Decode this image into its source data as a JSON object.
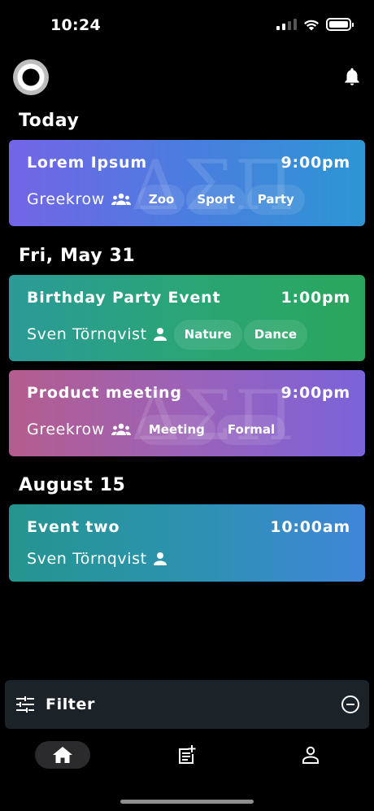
{
  "status_bar": {
    "time": "10:24"
  },
  "sections": [
    {
      "title": "Today"
    },
    {
      "title": "Fri, May 31"
    },
    {
      "title": "August 15"
    }
  ],
  "events": [
    {
      "title": "Lorem Ipsum",
      "time": "9:00pm",
      "owner": "Greekrow",
      "owner_icon": "group-icon",
      "watermark": "ΔΣΠ",
      "tags": [
        "Zoo",
        "Sport",
        "Party"
      ],
      "colors": [
        "#7465e6",
        "#2d96d4"
      ]
    },
    {
      "title": "Birthday Party Event",
      "time": "1:00pm",
      "owner": "Sven Törnqvist",
      "owner_icon": "person-icon",
      "tags": [
        "Nature",
        "Dance"
      ],
      "colors": [
        "#2b9a98",
        "#2aa65c"
      ]
    },
    {
      "title": "Product meeting",
      "time": "9:00pm",
      "owner": "Greekrow",
      "owner_icon": "group-icon",
      "watermark": "ΔΣΠ",
      "tags": [
        "Meeting",
        "Formal"
      ],
      "colors": [
        "#b45d8e",
        "#7b63da"
      ]
    },
    {
      "title": "Event two",
      "time": "10:00am",
      "owner": "Sven Törnqvist",
      "owner_icon": "person-icon",
      "tags": [],
      "colors": [
        "#25958f",
        "#3f86d8"
      ]
    }
  ],
  "filter": {
    "label": "Filter"
  },
  "tab_bar": {
    "tabs": [
      "home-icon",
      "add-note-icon",
      "person-icon"
    ],
    "active": "home-icon"
  }
}
